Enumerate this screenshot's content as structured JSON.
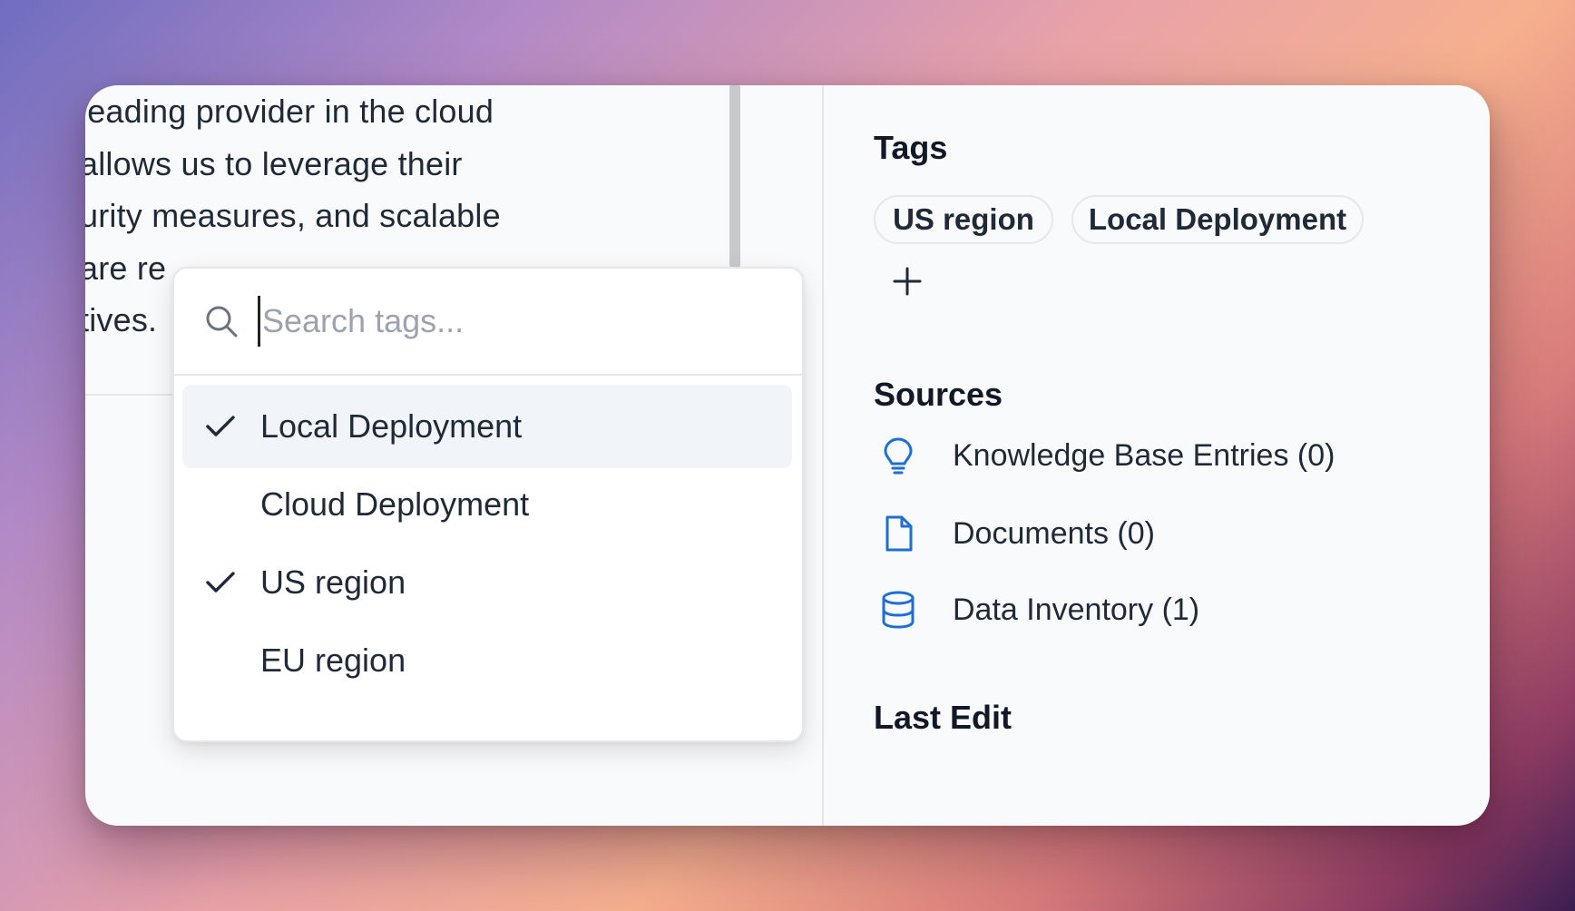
{
  "editor": {
    "lines": [
      "leading provider in the cloud",
      "allows us to leverage their",
      "urity measures, and scalable",
      "are re",
      "tives."
    ]
  },
  "tags": {
    "title": "Tags",
    "items": [
      "US region",
      "Local Deployment"
    ],
    "add_icon": "plus-icon"
  },
  "sources": {
    "title": "Sources",
    "items": [
      {
        "label": "Knowledge Base Entries (0)",
        "icon": "lightbulb-icon"
      },
      {
        "label": "Documents (0)",
        "icon": "document-icon"
      },
      {
        "label": "Data Inventory (1)",
        "icon": "database-icon"
      }
    ],
    "icon_color": "#1d6fd6"
  },
  "last_edit": {
    "title": "Last Edit"
  },
  "dropdown": {
    "search_placeholder": "Search tags...",
    "options": [
      {
        "label": "Local Deployment",
        "checked": true,
        "highlighted": true
      },
      {
        "label": "Cloud Deployment",
        "checked": false,
        "highlighted": false
      },
      {
        "label": "US region",
        "checked": true,
        "highlighted": false
      },
      {
        "label": "EU region",
        "checked": false,
        "highlighted": false
      }
    ]
  }
}
